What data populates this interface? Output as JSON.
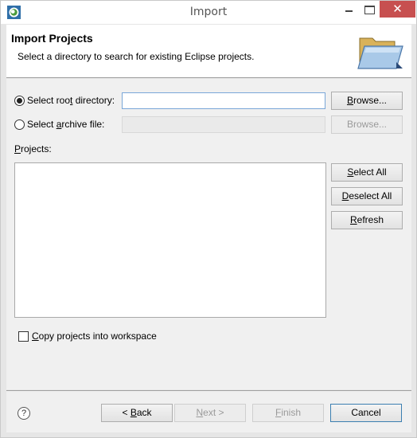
{
  "window": {
    "title": "Import",
    "close_glyph": "✕"
  },
  "banner": {
    "title": "Import Projects",
    "description": "Select a directory to search for existing Eclipse projects."
  },
  "root_dir": {
    "label_pre": "Select roo",
    "label_u": "t",
    "label_post": " directory:",
    "value": "",
    "browse": {
      "pre": "",
      "u": "B",
      "post": "rowse..."
    },
    "selected": true
  },
  "archive": {
    "label_pre": "Select ",
    "label_u": "a",
    "label_post": "rchive file:",
    "value": "",
    "browse": "Browse...",
    "selected": false
  },
  "projects": {
    "label_u": "P",
    "label_post": "rojects:",
    "items": [],
    "buttons": {
      "select_all": {
        "u": "S",
        "post": "elect All"
      },
      "deselect_all": {
        "u": "D",
        "post": "eselect All"
      },
      "refresh": {
        "u": "R",
        "post": "efresh"
      }
    }
  },
  "copy_option": {
    "label_pre": "",
    "label_u": "C",
    "label_post": "opy projects into workspace",
    "checked": false
  },
  "footer": {
    "help": "?",
    "back": {
      "pre": "< ",
      "u": "B",
      "post": "ack"
    },
    "next": {
      "u": "N",
      "post": "ext >"
    },
    "finish": {
      "u": "F",
      "post": "inish"
    },
    "cancel": "Cancel"
  }
}
